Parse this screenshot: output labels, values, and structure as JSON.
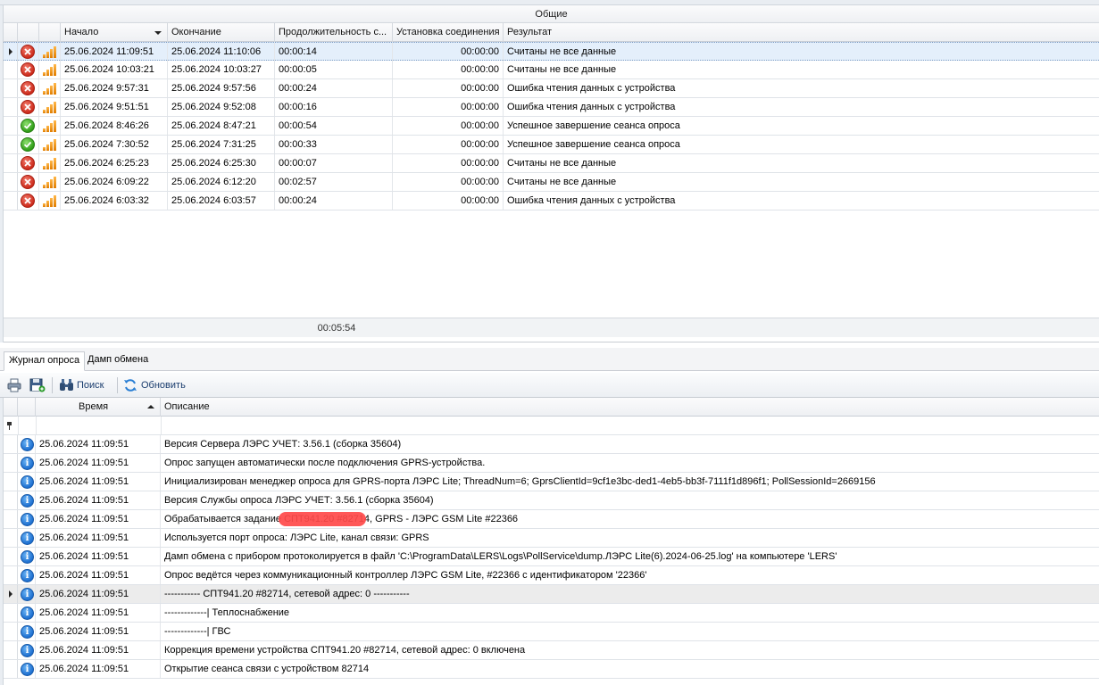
{
  "sessions": {
    "group_header": "Общие",
    "columns": [
      "Начало",
      "Окончание",
      "Продолжительность с...",
      "Установка соединения",
      "Результат"
    ],
    "rows": [
      {
        "status": "error",
        "start": "25.06.2024 11:09:51",
        "end": "25.06.2024 11:10:06",
        "duration": "00:00:14",
        "connect": "00:00:00",
        "result": "Считаны не все данные"
      },
      {
        "status": "error",
        "start": "25.06.2024 10:03:21",
        "end": "25.06.2024 10:03:27",
        "duration": "00:00:05",
        "connect": "00:00:00",
        "result": "Считаны не все данные"
      },
      {
        "status": "error",
        "start": "25.06.2024 9:57:31",
        "end": "25.06.2024 9:57:56",
        "duration": "00:00:24",
        "connect": "00:00:00",
        "result": "Ошибка чтения данных с устройства"
      },
      {
        "status": "error",
        "start": "25.06.2024 9:51:51",
        "end": "25.06.2024 9:52:08",
        "duration": "00:00:16",
        "connect": "00:00:00",
        "result": "Ошибка чтения данных с устройства"
      },
      {
        "status": "ok",
        "start": "25.06.2024 8:46:26",
        "end": "25.06.2024 8:47:21",
        "duration": "00:00:54",
        "connect": "00:00:00",
        "result": "Успешное завершение сеанса опроса"
      },
      {
        "status": "ok",
        "start": "25.06.2024 7:30:52",
        "end": "25.06.2024 7:31:25",
        "duration": "00:00:33",
        "connect": "00:00:00",
        "result": "Успешное завершение сеанса опроса"
      },
      {
        "status": "error",
        "start": "25.06.2024 6:25:23",
        "end": "25.06.2024 6:25:30",
        "duration": "00:00:07",
        "connect": "00:00:00",
        "result": "Считаны не все данные"
      },
      {
        "status": "error",
        "start": "25.06.2024 6:09:22",
        "end": "25.06.2024 6:12:20",
        "duration": "00:02:57",
        "connect": "00:00:00",
        "result": "Считаны не все данные"
      },
      {
        "status": "error",
        "start": "25.06.2024 6:03:32",
        "end": "25.06.2024 6:03:57",
        "duration": "00:00:24",
        "connect": "00:00:00",
        "result": "Ошибка чтения данных с устройства"
      }
    ],
    "total_duration": "00:05:54"
  },
  "tabs": [
    "Журнал опроса",
    "Дамп обмена"
  ],
  "toolbar": {
    "print_icon": "printer-icon",
    "save_icon": "save-icon",
    "search_label": "Поиск",
    "refresh_label": "Обновить"
  },
  "log": {
    "columns": [
      "Время",
      "Описание"
    ],
    "rows": [
      {
        "time": "25.06.2024 11:09:51",
        "desc": "Версия Сервера ЛЭРС УЧЕТ: 3.56.1 (сборка 35604)"
      },
      {
        "time": "25.06.2024 11:09:51",
        "desc": "Опрос запущен автоматически после подключения GPRS-устройства."
      },
      {
        "time": "25.06.2024 11:09:51",
        "desc": "Инициализирован менеджер опроса для GPRS-порта ЛЭРС Lite; ThreadNum=6; GprsClientId=9cf1e3bc-ded1-4eb5-bb3f-7111f1d896f1; PollSessionId=2669156"
      },
      {
        "time": "25.06.2024 11:09:51",
        "desc": "Версия Службы опроса ЛЭРС УЧЕТ: 3.56.1 (сборка 35604)"
      },
      {
        "time": "25.06.2024 11:09:51",
        "desc": "Обрабатывается задание                          СПТ941.20 #82714, GPRS - ЛЭРС GSM Lite #22366"
      },
      {
        "time": "25.06.2024 11:09:51",
        "desc": "Используется порт опроса: ЛЭРС Lite, канал связи: GPRS"
      },
      {
        "time": "25.06.2024 11:09:51",
        "desc": "Дамп обмена с прибором протоколируется в файл 'C:\\ProgramData\\LERS\\Logs\\PollService\\dump.ЛЭРС Lite(6).2024-06-25.log' на компьютере 'LERS'"
      },
      {
        "time": "25.06.2024 11:09:51",
        "desc": "Опрос ведётся через коммуникационный контроллер ЛЭРС GSM Lite, #22366 с идентификатором '22366'"
      },
      {
        "time": "25.06.2024 11:09:51",
        "desc": "----------- СПТ941.20 #82714, сетевой адрес: 0 -----------"
      },
      {
        "time": "25.06.2024 11:09:51",
        "desc": "-------------| Теплоснабжение"
      },
      {
        "time": "25.06.2024 11:09:51",
        "desc": "-------------| ГВС"
      },
      {
        "time": "25.06.2024 11:09:51",
        "desc": "Коррекция времени устройства СПТ941.20 #82714, сетевой адрес: 0 включена"
      },
      {
        "time": "25.06.2024 11:09:51",
        "desc": "Открытие сеанса связи с устройством 82714"
      }
    ]
  }
}
